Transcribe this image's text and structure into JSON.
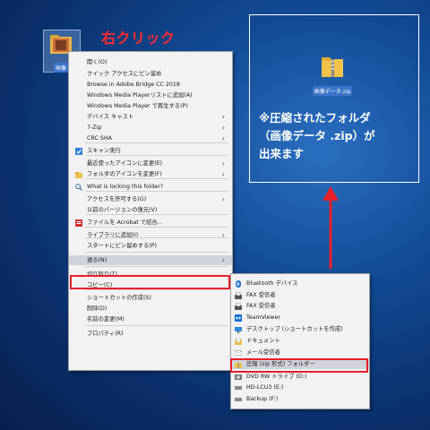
{
  "annotation": {
    "right_click_label": "右クリック",
    "result_note_line1": "※圧縮されたフォルダ",
    "result_note_line2": "（画像データ .zip）が",
    "result_note_line3": "出来ます"
  },
  "desktop": {
    "source_icon_label": "画像",
    "result_icon_label": "画像データ.zip"
  },
  "context_menu": {
    "items": [
      {
        "label": "開く(O)",
        "icon": "none-icon"
      },
      {
        "label": "クイック アクセスにピン留め",
        "icon": "none-icon"
      },
      {
        "label": "Browse in Adobe Bridge CC 2018",
        "icon": "none-icon"
      },
      {
        "label": "Windows Media Playerリストに追加(A)",
        "icon": "none-icon"
      },
      {
        "label": "Windows Media Player で再生する(P)",
        "icon": "none-icon"
      },
      {
        "label": "デバイス キャスト",
        "icon": "none-icon",
        "submenu": true
      },
      {
        "label": "7-Zip",
        "icon": "none-icon",
        "submenu": true
      },
      {
        "label": "CRC SHA",
        "icon": "none-icon",
        "submenu": true
      },
      {
        "label": "スキャン実行",
        "icon": "shield-icon"
      },
      {
        "label": "最近使ったアイコンに変更(E)",
        "icon": "none-icon",
        "submenu": true
      },
      {
        "label": "フォルダのアイコンを変更(F)",
        "icon": "folder-icon",
        "submenu": true
      },
      {
        "label": "What is locking this folder?",
        "icon": "search-icon"
      },
      {
        "label": "アクセスを許可する(G)",
        "icon": "none-icon",
        "submenu": true
      },
      {
        "label": "以前のバージョンの復元(V)",
        "icon": "none-icon"
      },
      {
        "label": "ファイルを Acrobat で結合...",
        "icon": "pdf-icon"
      },
      {
        "label": "ライブラリに追加(I)",
        "icon": "none-icon",
        "submenu": true
      },
      {
        "label": "スタートにピン留めする(P)",
        "icon": "none-icon"
      },
      {
        "label": "送る(N)",
        "icon": "none-icon",
        "submenu": true
      },
      {
        "label": "切り取り(T)",
        "icon": "none-icon"
      },
      {
        "label": "コピー(C)",
        "icon": "none-icon"
      },
      {
        "label": "ショートカットの作成(S)",
        "icon": "none-icon"
      },
      {
        "label": "削除(D)",
        "icon": "none-icon"
      },
      {
        "label": "名前の変更(M)",
        "icon": "none-icon"
      },
      {
        "label": "プロパティ(R)",
        "icon": "none-icon"
      }
    ]
  },
  "send_to_menu": {
    "items": [
      {
        "label": "Bluetooth デバイス",
        "icon": "bluetooth-icon"
      },
      {
        "label": "FAX 受信者",
        "icon": "fax-icon"
      },
      {
        "label": "FAX 受信者",
        "icon": "fax-icon"
      },
      {
        "label": "TeamViewer",
        "icon": "teamviewer-icon"
      },
      {
        "label": "デスクトップ (ショートカットを作成)",
        "icon": "desktop-icon"
      },
      {
        "label": "ドキュメント",
        "icon": "documents-icon"
      },
      {
        "label": "メール受信者",
        "icon": "mail-icon"
      },
      {
        "label": "圧縮 (zip 形式) フォルダー",
        "icon": "zip-folder-icon"
      },
      {
        "label": "DVD RW ドライブ (D:)",
        "icon": "dvd-icon"
      },
      {
        "label": "HD-LCU3 (E:)",
        "icon": "drive-icon"
      },
      {
        "label": "Backup (F:)",
        "icon": "drive-icon"
      }
    ]
  },
  "colors": {
    "annotation_red": "#e8202a",
    "menu_bg": "#f2f2f2",
    "highlight": "#cfd4dc"
  }
}
